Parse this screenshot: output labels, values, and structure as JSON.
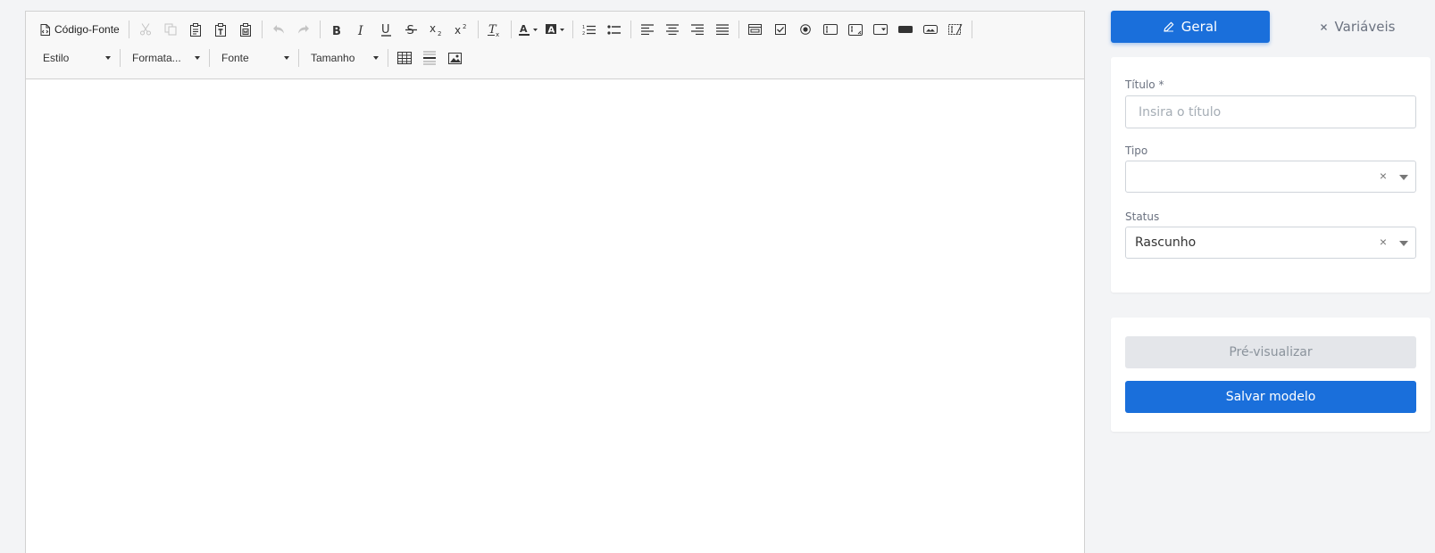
{
  "toolbar": {
    "source_label": "Código-Fonte",
    "style_label": "Estilo",
    "format_label": "Formata...",
    "font_label": "Fonte",
    "size_label": "Tamanho"
  },
  "tabs": {
    "general_label": "Geral",
    "variables_label": "Variáveis"
  },
  "form": {
    "title_label": "Título *",
    "title_placeholder": "Insira o título",
    "title_value": "",
    "type_label": "Tipo",
    "type_value": "",
    "status_label": "Status",
    "status_value": "Rascunho",
    "clear_symbol": "×"
  },
  "actions": {
    "preview_label": "Pré-visualizar",
    "save_label": "Salvar modelo"
  },
  "colors": {
    "accent": "#1a6fdb",
    "disabled_button_bg": "#e4e6ea",
    "page_bg": "#f3f4f6"
  }
}
